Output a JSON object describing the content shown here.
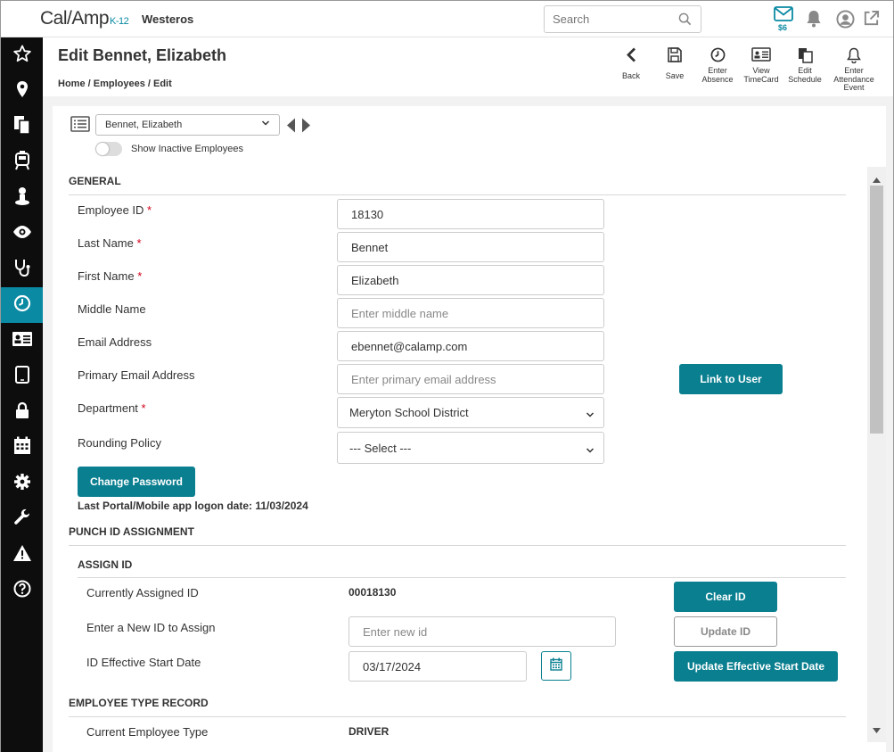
{
  "app": {
    "logo_text": "Cal/Amp",
    "logo_suffix": "K-12",
    "org_name": "Westeros"
  },
  "search": {
    "placeholder": "Search"
  },
  "header_icons": {
    "mail_count": "$6",
    "icons": [
      "mail-icon",
      "bell-icon",
      "user-circle-icon",
      "external-link-icon"
    ]
  },
  "sidebar": {
    "items": [
      {
        "icon": "star-icon"
      },
      {
        "icon": "map-pin-icon"
      },
      {
        "icon": "documents-icon"
      },
      {
        "icon": "bus-icon"
      },
      {
        "icon": "person-icon"
      },
      {
        "icon": "eye-icon"
      },
      {
        "icon": "stethoscope-icon"
      },
      {
        "icon": "clock-icon",
        "active": true
      },
      {
        "icon": "id-card-icon"
      },
      {
        "icon": "tablet-icon"
      },
      {
        "icon": "lock-icon"
      },
      {
        "icon": "calendar-icon"
      },
      {
        "icon": "gear-icon"
      },
      {
        "icon": "wrench-icon"
      },
      {
        "icon": "warning-icon"
      },
      {
        "icon": "help-icon"
      }
    ]
  },
  "page": {
    "title": "Edit Bennet, Elizabeth",
    "breadcrumb": "Home / Employees / Edit"
  },
  "toolbar": {
    "back": "Back",
    "save": "Save",
    "enter_absence": [
      "Enter",
      "Absence"
    ],
    "view_timecard": [
      "View",
      "TimeCard"
    ],
    "edit_schedule": [
      "Edit",
      "Schedule"
    ],
    "enter_attendance": [
      "Enter",
      "Attendance",
      "Event"
    ]
  },
  "selector": {
    "employee": "Bennet, Elizabeth",
    "show_inactive_label": "Show Inactive Employees",
    "show_inactive": false
  },
  "general": {
    "title": "GENERAL",
    "fields": {
      "employee_id": {
        "label": "Employee ID",
        "required": "*",
        "value": "18130"
      },
      "last_name": {
        "label": "Last Name",
        "required": "*",
        "value": "Bennet"
      },
      "first_name": {
        "label": "First Name",
        "required": "*",
        "value": "Elizabeth"
      },
      "middle_name": {
        "label": "Middle Name",
        "value": "",
        "placeholder": "Enter middle name"
      },
      "email": {
        "label": "Email Address",
        "value": "ebennet@calamp.com"
      },
      "primary_email": {
        "label": "Primary Email Address",
        "value": "",
        "placeholder": "Enter primary email address"
      },
      "department": {
        "label": "Department",
        "required": "*",
        "value": "Meryton School District"
      },
      "rounding_policy": {
        "label": "Rounding Policy",
        "value": "--- Select ---"
      }
    },
    "link_to_user": "Link to User",
    "change_password": "Change Password",
    "last_logon": "Last Portal/Mobile app logon date: 11/03/2024"
  },
  "punch_id": {
    "title": "PUNCH ID ASSIGNMENT",
    "subtitle": "ASSIGN ID",
    "currently_assigned_label": "Currently Assigned ID",
    "currently_assigned_value": "00018130",
    "new_id_label": "Enter a New ID to Assign",
    "new_id_placeholder": "Enter new id",
    "effective_date_label": "ID Effective Start Date",
    "effective_date_value": "03/17/2024",
    "clear_id": "Clear ID",
    "update_id": "Update ID",
    "update_effective": "Update Effective Start Date"
  },
  "employee_type": {
    "title": "EMPLOYEE TYPE RECORD",
    "current_label": "Current Employee Type",
    "current_value": "DRIVER"
  },
  "colors": {
    "accent": "#0a7f90",
    "sidebar": "#0d0d0d",
    "required": "#d0021b"
  }
}
